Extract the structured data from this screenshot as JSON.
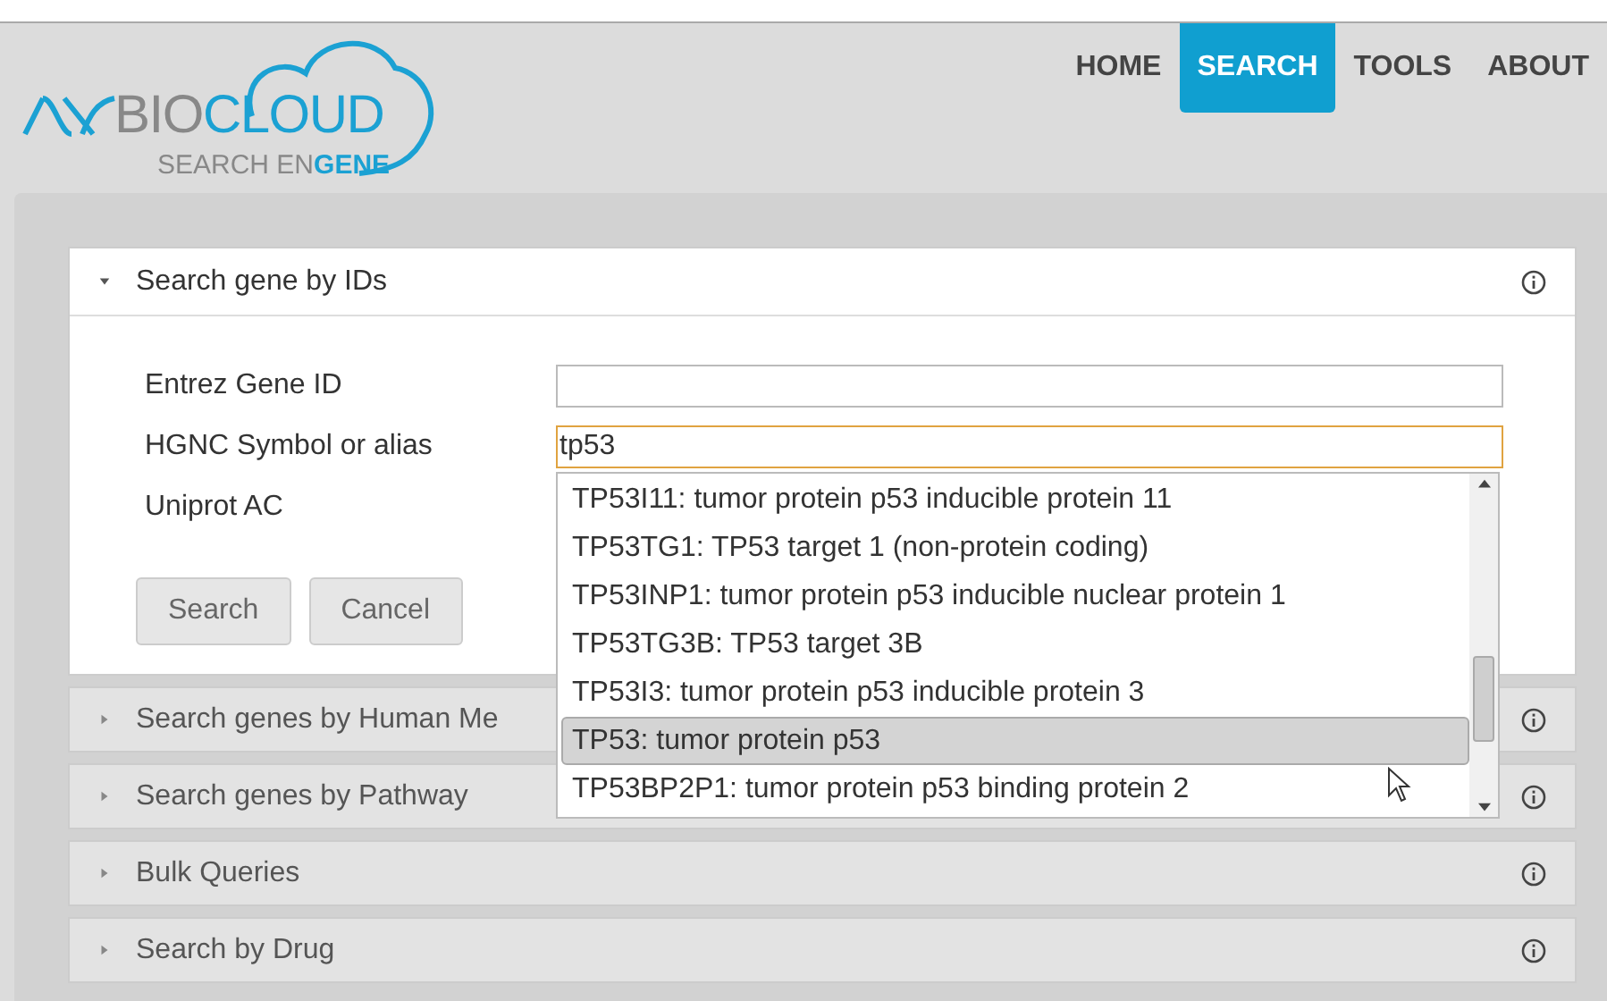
{
  "logo": {
    "brand_prefix": "BIO",
    "brand_suffix": "CLOUD",
    "tagline_prefix": "SEARCH EN",
    "tagline_suffix": "GENE"
  },
  "nav": [
    {
      "label": "HOME",
      "selected": false
    },
    {
      "label": "SEARCH",
      "selected": true
    },
    {
      "label": "TOOLS",
      "selected": false
    },
    {
      "label": "ABOUT",
      "selected": false
    }
  ],
  "sections": [
    {
      "title": "Search gene by IDs",
      "expanded": true,
      "fields": [
        {
          "label": "Entrez Gene ID"
        },
        {
          "label": "HGNC Symbol or alias",
          "value": "tp53",
          "focused": true
        },
        {
          "label": "Uniprot AC"
        }
      ],
      "buttons": [
        "Search",
        "Cancel"
      ]
    },
    {
      "title": "Search genes by Human Me",
      "expanded": false
    },
    {
      "title": "Search genes by Pathway",
      "expanded": false
    },
    {
      "title": "Bulk Queries",
      "expanded": false
    },
    {
      "title": "Search by Drug",
      "expanded": false
    }
  ],
  "suggestions": [
    {
      "text": "TP53I11: tumor protein p53 inducible protein 11",
      "selected": false
    },
    {
      "text": "TP53TG1: TP53 target 1 (non-protein coding)",
      "selected": false
    },
    {
      "text": "TP53INP1: tumor protein p53 inducible nuclear protein 1",
      "selected": false
    },
    {
      "text": "TP53TG3B: TP53 target 3B",
      "selected": false
    },
    {
      "text": "TP53I3: tumor protein p53 inducible protein 3",
      "selected": false
    },
    {
      "text": "TP53: tumor protein p53",
      "selected": true
    },
    {
      "text": "TP53BP2P1: tumor protein p53 binding protein  2",
      "selected": false
    }
  ]
}
